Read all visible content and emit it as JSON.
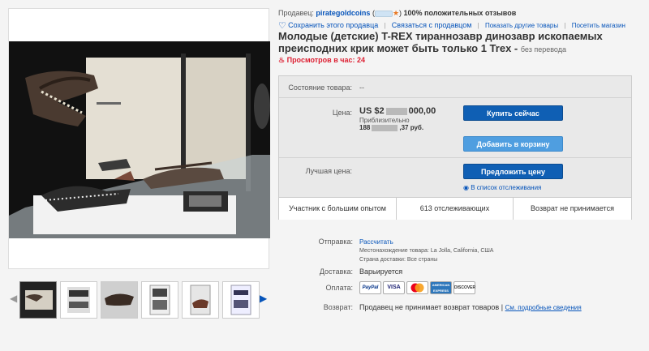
{
  "seller": {
    "label": "Продавец:",
    "name": "pirategoldcoins",
    "feedback": "100% положительных отзывов"
  },
  "actions": {
    "save_seller": "Сохранить этого продавца",
    "contact_seller": "Связаться с продавцом",
    "other_items": "Показать другие товары",
    "visit_store": "Посетить магазин"
  },
  "listing": {
    "title": "Молодые (детские) T-REX тираннозавр динозавр ископаемых преисподних крик может быть только 1 Trex -",
    "translation_note": "без перевода",
    "views_per_hour": "Просмотров в час: 24"
  },
  "buybox": {
    "condition_label": "Состояние товара:",
    "condition_value": "--",
    "price_label": "Цена:",
    "price_prefix": "US $2",
    "price_suffix": "000,00",
    "approx_label": "Приблизительно",
    "rub_prefix": "188",
    "rub_suffix": ",37 руб.",
    "buy_now": "Купить сейчас",
    "add_to_cart": "Добавить в корзину",
    "best_offer_label": "Лучшая цена:",
    "make_offer": "Предложить цену",
    "watchlist": "В список отслеживания",
    "stats": [
      "Участник с большим опытом",
      "613 отслеживающих",
      "Возврат не принимается"
    ]
  },
  "shipping": {
    "label": "Отправка:",
    "value": "Рассчитать",
    "location_label": "Местонахождение товара:",
    "location": "La Jolla, California, США",
    "countries_label": "Страна доставки:",
    "countries": "Все страны"
  },
  "delivery": {
    "label": "Доставка:",
    "value": "Варьируется"
  },
  "payment": {
    "label": "Оплата:",
    "methods": [
      "PayPal",
      "VISA",
      "MasterCard",
      "AMERICAN EXPRESS",
      "DISCOVER"
    ]
  },
  "returns": {
    "label": "Возврат:",
    "value": "Продавец не принимает возврат товаров |",
    "details_link": "См. подробные сведения"
  },
  "icons": {
    "heart": "heart-icon",
    "flame": "flame-icon",
    "eye": "eye-icon",
    "star": "star-icon",
    "arrow_left": "chevron-left-icon",
    "arrow_right": "chevron-right-icon"
  },
  "colors": {
    "link": "#0654ba",
    "views": "#dd1e31",
    "buy_button": "#0f5fb4",
    "cart_button": "#4f9ee0",
    "buybox_bg": "#e9e9e9"
  }
}
